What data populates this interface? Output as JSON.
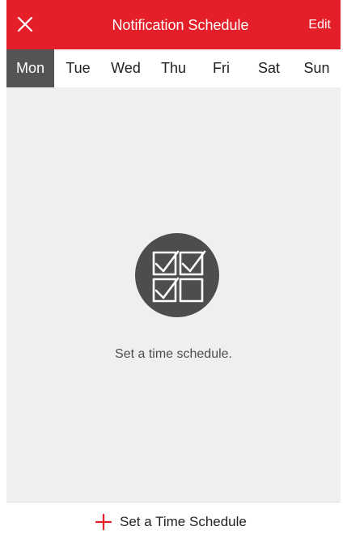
{
  "header": {
    "title": "Notification Schedule",
    "edit_label": "Edit",
    "close_icon": "close-icon"
  },
  "days": [
    {
      "label": "Mon",
      "selected": true
    },
    {
      "label": "Tue",
      "selected": false
    },
    {
      "label": "Wed",
      "selected": false
    },
    {
      "label": "Thu",
      "selected": false
    },
    {
      "label": "Fri",
      "selected": false
    },
    {
      "label": "Sat",
      "selected": false
    },
    {
      "label": "Sun",
      "selected": false
    }
  ],
  "empty_state": {
    "icon": "schedule-checklist-icon",
    "message": "Set a time schedule."
  },
  "footer": {
    "add_icon": "plus-icon",
    "add_label": "Set a Time Schedule"
  },
  "colors": {
    "header": "#e51f2a",
    "selected_day": "#545454",
    "content_bg": "#efefef",
    "icon_bg": "#4d4d4d"
  }
}
